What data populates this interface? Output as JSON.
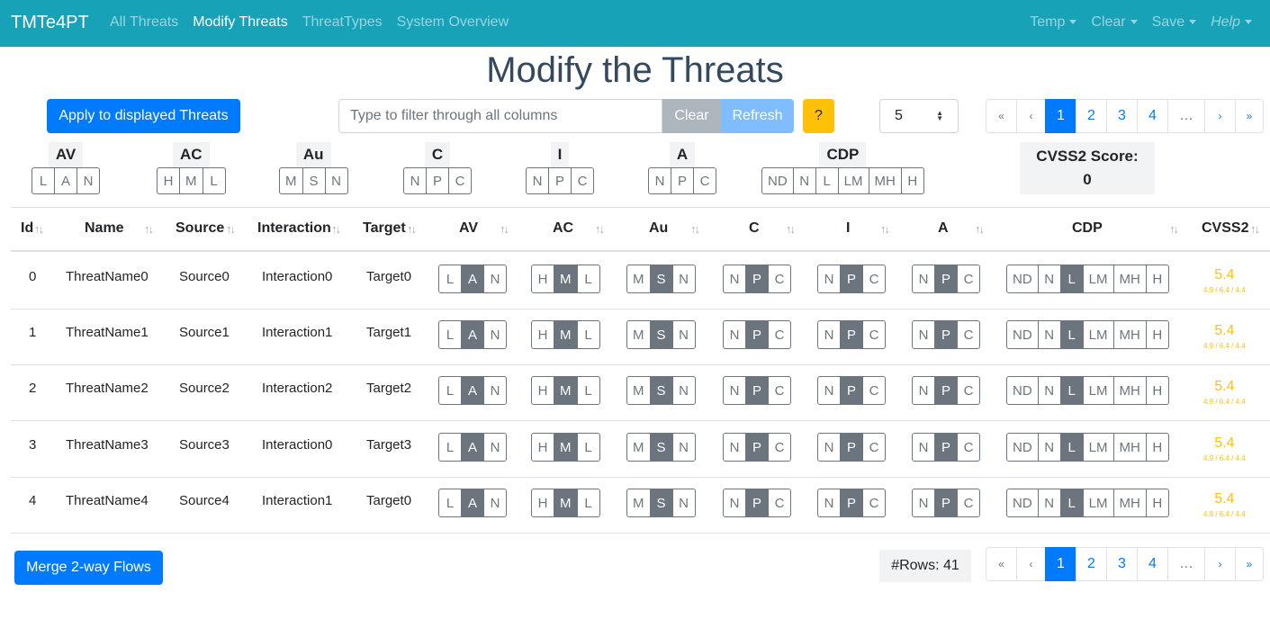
{
  "navbar": {
    "brand": "TMTe4PT",
    "links": [
      "All Threats",
      "Modify Threats",
      "ThreatTypes",
      "System Overview"
    ],
    "right": [
      "Temp",
      "Clear",
      "Save",
      "Help"
    ]
  },
  "page": {
    "title": "Modify the Threats"
  },
  "toolbar": {
    "apply_label": "Apply to displayed Threats",
    "filter_placeholder": "Type to filter through all columns",
    "clear_label": "Clear",
    "refresh_label": "Refresh",
    "help_label": "?",
    "page_size": "5"
  },
  "pagination": {
    "first": "«",
    "prev": "‹",
    "pages": [
      "1",
      "2",
      "3",
      "4"
    ],
    "ellipsis": "…",
    "next": "›",
    "last": "»",
    "active": "1"
  },
  "metrics": [
    {
      "label": "AV",
      "options": [
        "L",
        "A",
        "N"
      ]
    },
    {
      "label": "AC",
      "options": [
        "H",
        "M",
        "L"
      ]
    },
    {
      "label": "Au",
      "options": [
        "M",
        "S",
        "N"
      ]
    },
    {
      "label": "C",
      "options": [
        "N",
        "P",
        "C"
      ]
    },
    {
      "label": "I",
      "options": [
        "N",
        "P",
        "C"
      ]
    },
    {
      "label": "A",
      "options": [
        "N",
        "P",
        "C"
      ]
    },
    {
      "label": "CDP",
      "options": [
        "ND",
        "N",
        "L",
        "LM",
        "MH",
        "H"
      ]
    }
  ],
  "score": {
    "label": "CVSS2 Score:",
    "value": "0"
  },
  "table": {
    "headers": [
      "Id",
      "Name",
      "Source",
      "Interaction",
      "Target",
      "AV",
      "AC",
      "Au",
      "C",
      "I",
      "A",
      "CDP",
      "CVSS2"
    ],
    "rows": [
      {
        "id": "0",
        "name": "ThreatName0",
        "source": "Source0",
        "interaction": "Interaction0",
        "target": "Target0",
        "score": "5.4",
        "sub": "4.9 / 6.4 / 4.4"
      },
      {
        "id": "1",
        "name": "ThreatName1",
        "source": "Source1",
        "interaction": "Interaction1",
        "target": "Target1",
        "score": "5.4",
        "sub": "4.9 / 6.4 / 4.4"
      },
      {
        "id": "2",
        "name": "ThreatName2",
        "source": "Source2",
        "interaction": "Interaction2",
        "target": "Target2",
        "score": "5.4",
        "sub": "4.9 / 6.4 / 4.4"
      },
      {
        "id": "3",
        "name": "ThreatName3",
        "source": "Source3",
        "interaction": "Interaction0",
        "target": "Target3",
        "score": "5.4",
        "sub": "4.9 / 6.4 / 4.4"
      },
      {
        "id": "4",
        "name": "ThreatName4",
        "source": "Source4",
        "interaction": "Interaction1",
        "target": "Target0",
        "score": "5.4",
        "sub": "4.9 / 6.4 / 4.4"
      }
    ],
    "row_selected": {
      "AV": "A",
      "AC": "M",
      "Au": "S",
      "C": "P",
      "I": "P",
      "A": "P",
      "CDP": "L"
    }
  },
  "footer": {
    "merge_label": "Merge 2-way Flows",
    "rows_count": "#Rows: 41"
  },
  "colors": {
    "navbar": "#17a2b8",
    "primary": "#007bff",
    "warning": "#ffc107",
    "secondary": "#6c757d"
  }
}
